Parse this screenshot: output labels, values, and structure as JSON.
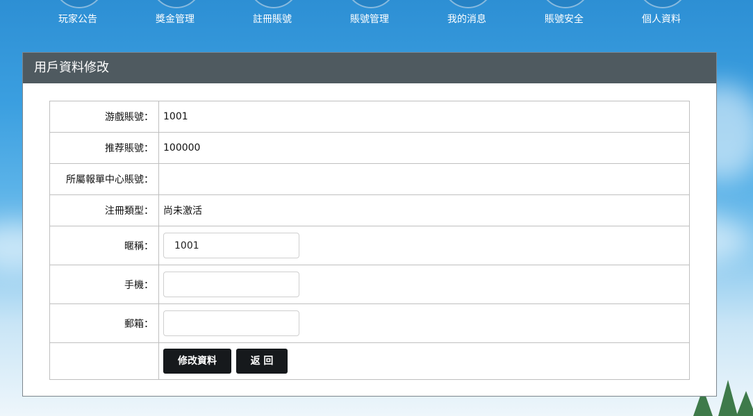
{
  "nav": {
    "items": [
      {
        "label": "玩家公告"
      },
      {
        "label": "獎金管理"
      },
      {
        "label": "註冊賬號"
      },
      {
        "label": "賬號管理"
      },
      {
        "label": "我的消息"
      },
      {
        "label": "賬號安全"
      },
      {
        "label": "個人資料"
      }
    ]
  },
  "panel": {
    "title": "用戶資料修改"
  },
  "form": {
    "game_account_label": "游戲賬號：",
    "game_account_value": "1001",
    "referrer_label": "推荐賬號：",
    "referrer_value": "100000",
    "center_label": "所屬報單中心賬號：",
    "center_value": "",
    "reg_type_label": "注冊類型：",
    "reg_type_value": "尚未激活",
    "nickname_label": "暱稱：",
    "nickname_value": "1001",
    "phone_label": "手機：",
    "phone_value": "",
    "email_label": "郵箱：",
    "email_value": "",
    "submit_label": "修改資料",
    "back_label": "返 回"
  }
}
